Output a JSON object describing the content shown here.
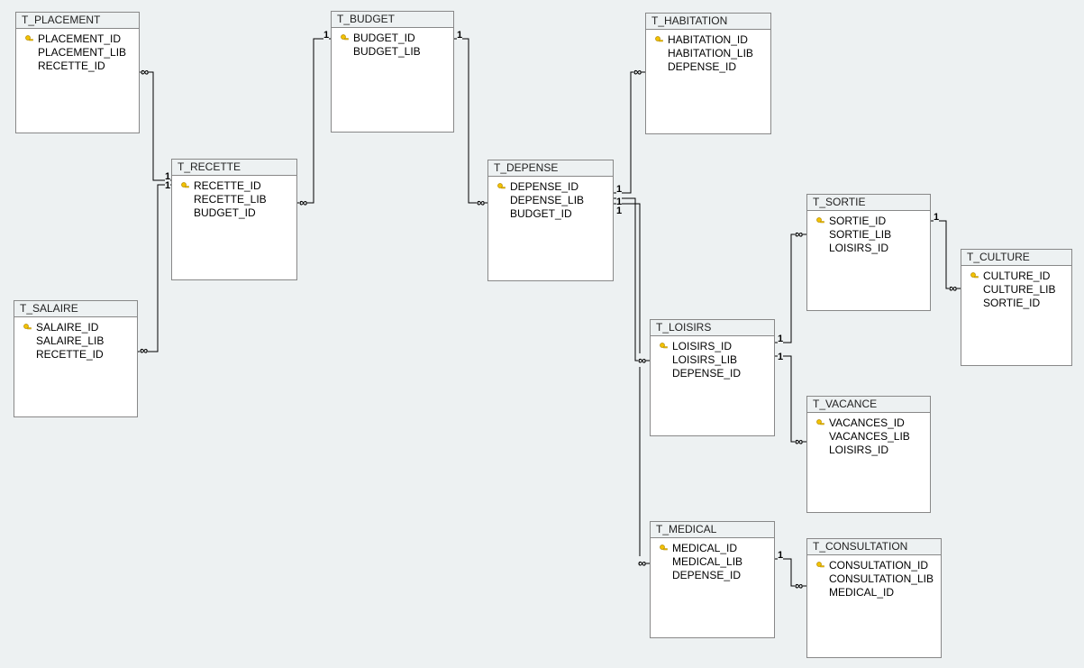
{
  "tables": {
    "placement": {
      "title": "T_PLACEMENT",
      "fields": [
        {
          "name": "PLACEMENT_ID",
          "pk": true
        },
        {
          "name": "PLACEMENT_LIB",
          "pk": false
        },
        {
          "name": "RECETTE_ID",
          "pk": false
        }
      ]
    },
    "salaire": {
      "title": "T_SALAIRE",
      "fields": [
        {
          "name": "SALAIRE_ID",
          "pk": true
        },
        {
          "name": "SALAIRE_LIB",
          "pk": false
        },
        {
          "name": "RECETTE_ID",
          "pk": false
        }
      ]
    },
    "recette": {
      "title": "T_RECETTE",
      "fields": [
        {
          "name": "RECETTE_ID",
          "pk": true
        },
        {
          "name": "RECETTE_LIB",
          "pk": false
        },
        {
          "name": "BUDGET_ID",
          "pk": false
        }
      ]
    },
    "budget": {
      "title": "T_BUDGET",
      "fields": [
        {
          "name": "BUDGET_ID",
          "pk": true
        },
        {
          "name": "BUDGET_LIB",
          "pk": false
        }
      ]
    },
    "depense": {
      "title": "T_DEPENSE",
      "fields": [
        {
          "name": "DEPENSE_ID",
          "pk": true
        },
        {
          "name": "DEPENSE_LIB",
          "pk": false
        },
        {
          "name": "BUDGET_ID",
          "pk": false
        }
      ]
    },
    "habitation": {
      "title": "T_HABITATION",
      "fields": [
        {
          "name": "HABITATION_ID",
          "pk": true
        },
        {
          "name": "HABITATION_LIB",
          "pk": false
        },
        {
          "name": "DEPENSE_ID",
          "pk": false
        }
      ]
    },
    "loisirs": {
      "title": "T_LOISIRS",
      "fields": [
        {
          "name": "LOISIRS_ID",
          "pk": true
        },
        {
          "name": "LOISIRS_LIB",
          "pk": false
        },
        {
          "name": "DEPENSE_ID",
          "pk": false
        }
      ]
    },
    "medical": {
      "title": "T_MEDICAL",
      "fields": [
        {
          "name": "MEDICAL_ID",
          "pk": true
        },
        {
          "name": "MEDICAL_LIB",
          "pk": false
        },
        {
          "name": "DEPENSE_ID",
          "pk": false
        }
      ]
    },
    "sortie": {
      "title": "T_SORTIE",
      "fields": [
        {
          "name": "SORTIE_ID",
          "pk": true
        },
        {
          "name": "SORTIE_LIB",
          "pk": false
        },
        {
          "name": "LOISIRS_ID",
          "pk": false
        }
      ]
    },
    "vacance": {
      "title": "T_VACANCE",
      "fields": [
        {
          "name": "VACANCES_ID",
          "pk": true
        },
        {
          "name": "VACANCES_LIB",
          "pk": false
        },
        {
          "name": "LOISIRS_ID",
          "pk": false
        }
      ]
    },
    "culture": {
      "title": "T_CULTURE",
      "fields": [
        {
          "name": "CULTURE_ID",
          "pk": true
        },
        {
          "name": "CULTURE_LIB",
          "pk": false
        },
        {
          "name": "SORTIE_ID",
          "pk": false
        }
      ]
    },
    "consultation": {
      "title": "T_CONSULTATION",
      "fields": [
        {
          "name": "CONSULTATION_ID",
          "pk": true
        },
        {
          "name": "CONSULTATION_LIB",
          "pk": false
        },
        {
          "name": "MEDICAL_ID",
          "pk": false
        }
      ]
    }
  },
  "relationships": [
    {
      "from": "T_RECETTE",
      "to": "T_PLACEMENT",
      "type": "1:many"
    },
    {
      "from": "T_RECETTE",
      "to": "T_SALAIRE",
      "type": "1:many"
    },
    {
      "from": "T_BUDGET",
      "to": "T_RECETTE",
      "type": "1:many"
    },
    {
      "from": "T_BUDGET",
      "to": "T_DEPENSE",
      "type": "1:many"
    },
    {
      "from": "T_DEPENSE",
      "to": "T_HABITATION",
      "type": "1:many"
    },
    {
      "from": "T_DEPENSE",
      "to": "T_LOISIRS",
      "type": "1:many"
    },
    {
      "from": "T_DEPENSE",
      "to": "T_MEDICAL",
      "type": "1:many"
    },
    {
      "from": "T_LOISIRS",
      "to": "T_SORTIE",
      "type": "1:many"
    },
    {
      "from": "T_LOISIRS",
      "to": "T_VACANCE",
      "type": "1:many"
    },
    {
      "from": "T_SORTIE",
      "to": "T_CULTURE",
      "type": "1:many"
    },
    {
      "from": "T_MEDICAL",
      "to": "T_CONSULTATION",
      "type": "1:many"
    }
  ],
  "card_labels": {
    "one": "1",
    "many": "∞"
  }
}
